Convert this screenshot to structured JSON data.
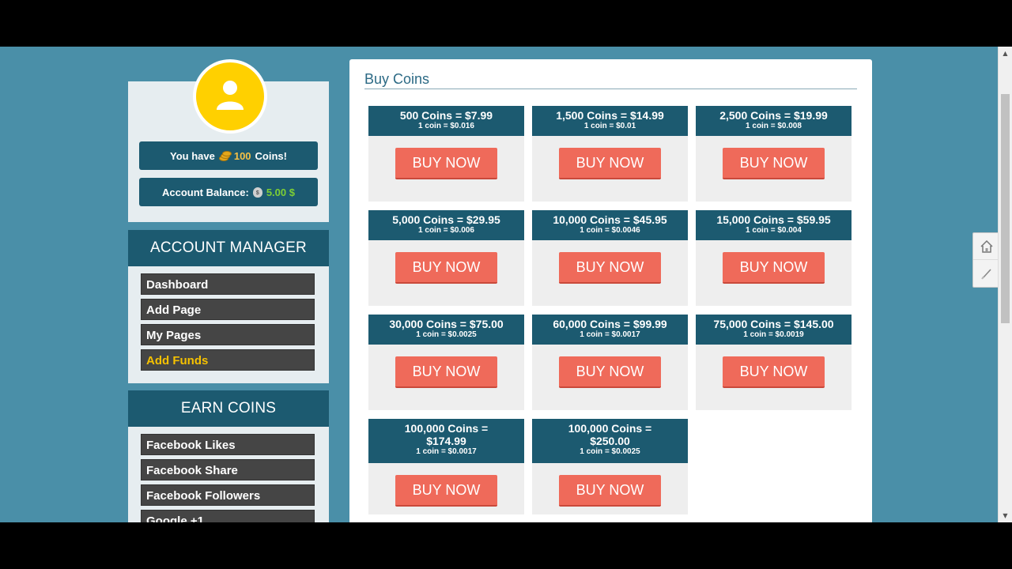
{
  "profile": {
    "coins_prefix": "You have",
    "coins_value": "100",
    "coins_suffix": "Coins!",
    "balance_label": "Account Balance:",
    "balance_value": "5.00 $"
  },
  "account_manager": {
    "title": "ACCOUNT MANAGER",
    "items": [
      {
        "label": "Dashboard"
      },
      {
        "label": "Add Page"
      },
      {
        "label": "My Pages"
      },
      {
        "label": "Add Funds",
        "active": true
      }
    ]
  },
  "earn_coins": {
    "title": "EARN COINS",
    "items": [
      {
        "label": "Facebook Likes"
      },
      {
        "label": "Facebook Share"
      },
      {
        "label": "Facebook Followers"
      },
      {
        "label": "Google +1"
      }
    ]
  },
  "main": {
    "title": "Buy Coins",
    "button_label": "BUY NOW",
    "packages": [
      {
        "title": "500 Coins = $7.99",
        "rate": "1 coin = $0.016"
      },
      {
        "title": "1,500 Coins = $14.99",
        "rate": "1 coin = $0.01"
      },
      {
        "title": "2,500 Coins = $19.99",
        "rate": "1 coin = $0.008"
      },
      {
        "title": "5,000 Coins = $29.95",
        "rate": "1 coin = $0.006"
      },
      {
        "title": "10,000 Coins = $45.95",
        "rate": "1 coin = $0.0046"
      },
      {
        "title": "15,000 Coins = $59.95",
        "rate": "1 coin = $0.004"
      },
      {
        "title": "30,000 Coins = $75.00",
        "rate": "1 coin = $0.0025"
      },
      {
        "title": "60,000 Coins = $99.99",
        "rate": "1 coin = $0.0017"
      },
      {
        "title": "75,000 Coins = $145.00",
        "rate": "1 coin = $0.0019"
      },
      {
        "title_line1": "100,000 Coins =",
        "title_line2": "$174.99",
        "rate": "1 coin = $0.0017"
      },
      {
        "title_line1": "100,000 Coins =",
        "title_line2": "$250.00",
        "rate": "1 coin = $0.0025"
      }
    ]
  },
  "icons": {
    "avatar": "user-icon",
    "coins": "coins-icon",
    "balance": "money-bag-icon",
    "widget_home": "home-icon",
    "widget_edit": "edit-icon"
  },
  "colors": {
    "page_bg": "#4a8fa8",
    "header_blue": "#1c5a70",
    "buy_button": "#ef6a5a",
    "avatar_yellow": "#ffd000",
    "active_menu": "#f5c100"
  }
}
